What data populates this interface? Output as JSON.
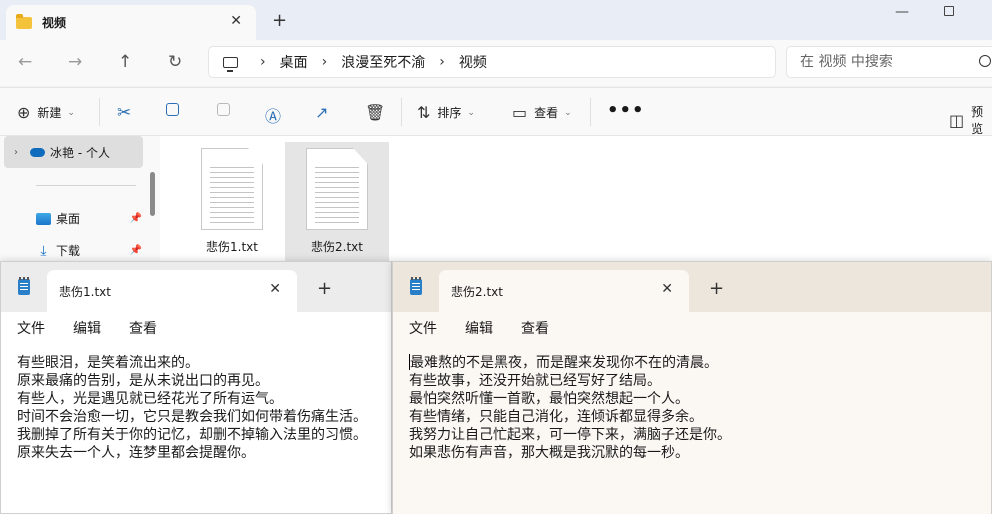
{
  "explorer": {
    "tab_title": "视频",
    "breadcrumbs": [
      "桌面",
      "浪漫至死不渝",
      "视频"
    ],
    "search_placeholder": "在 视频 中搜索",
    "commands": {
      "new": "新建",
      "sort": "排序",
      "view": "查看",
      "more": "•••",
      "preview": "预览"
    },
    "nav": {
      "onedrive": "冰艳 - 个人",
      "desktop": "桌面",
      "downloads": "下载"
    },
    "files": [
      {
        "name": "悲伤1.txt",
        "selected": false
      },
      {
        "name": "悲伤2.txt",
        "selected": true
      }
    ]
  },
  "notepad1": {
    "tab_title": "悲伤1.txt",
    "menu": [
      "文件",
      "编辑",
      "查看"
    ],
    "lines": [
      "有些眼泪，是笑着流出来的。",
      "原来最痛的告别，是从未说出口的再见。",
      "有些人，光是遇见就已经花光了所有运气。",
      "时间不会治愈一切，它只是教会我们如何带着伤痛生活。",
      "我删掉了所有关于你的记忆，却删不掉输入法里的习惯。",
      "原来失去一个人，连梦里都会提醒你。"
    ]
  },
  "notepad2": {
    "tab_title": "悲伤2.txt",
    "menu": [
      "文件",
      "编辑",
      "查看"
    ],
    "lines": [
      "最难熬的不是黑夜，而是醒来发现你不在的清晨。",
      "有些故事，还没开始就已经写好了结局。",
      "最怕突然听懂一首歌，最怕突然想起一个人。",
      "有些情绪，只能自己消化，连倾诉都显得多余。",
      "我努力让自己忙起来，可一停下来，满脑子还是你。",
      "如果悲伤有声音，那大概是我沉默的每一秒。"
    ]
  },
  "colors": {
    "accent": "#0f6cbd",
    "folder": "#f4c33b",
    "notepad_icon": "#2a7fc9"
  }
}
